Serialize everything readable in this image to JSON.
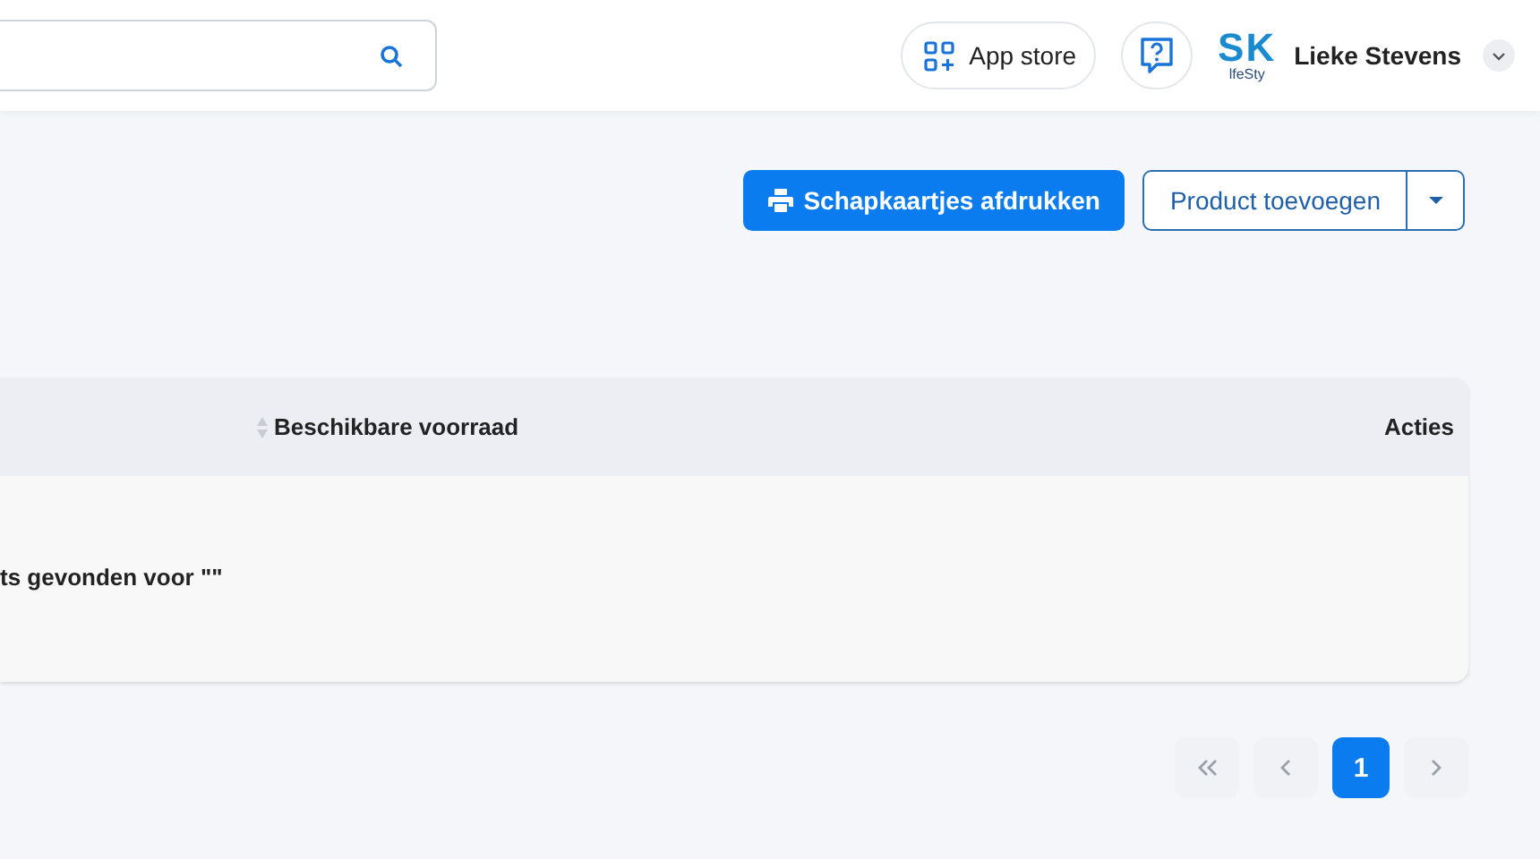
{
  "header": {
    "app_store": "App store",
    "logo": {
      "main": "SK",
      "sub": "lfeSty"
    },
    "user_name": "Lieke Stevens"
  },
  "actions": {
    "print_button": "Schapkaartjes afdrukken",
    "add_button": "Product toevoegen"
  },
  "table": {
    "columns": [
      {
        "label": "Beschikbare voorraad",
        "sortable": true
      },
      {
        "label": "Acties",
        "sortable": false
      }
    ],
    "empty_message": "ts gevonden voor \"\""
  },
  "pagination": {
    "pages": [
      {
        "label": "1",
        "selected": true
      }
    ]
  }
}
